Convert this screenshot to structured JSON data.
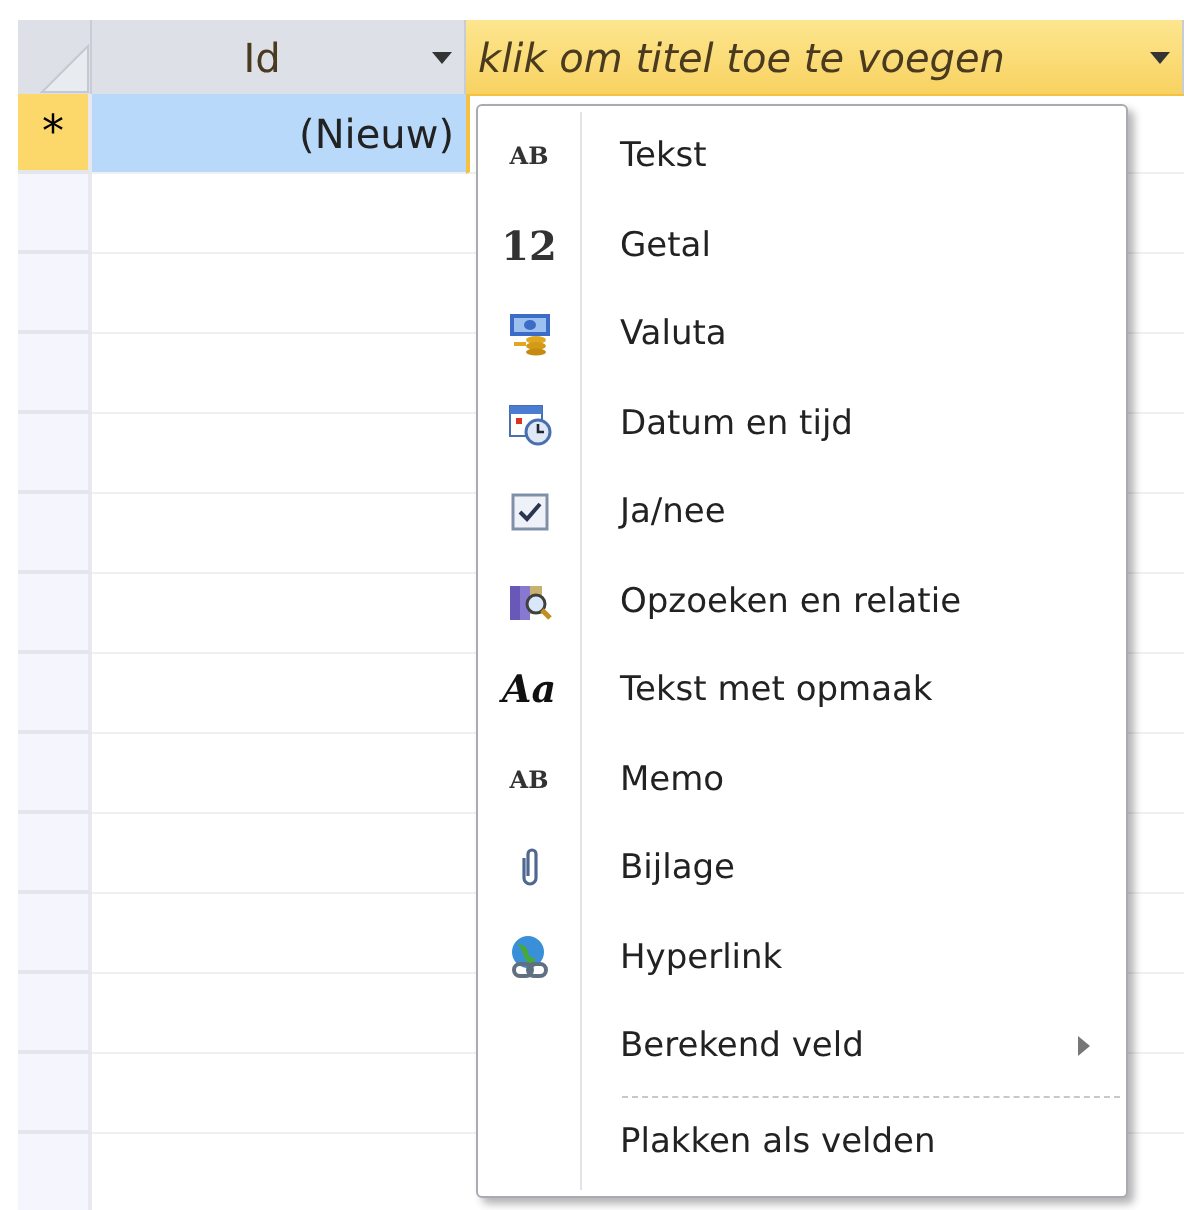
{
  "columns": [
    {
      "title": "Id",
      "selected": false
    },
    {
      "title": "klik om titel toe te voegen",
      "selected": true
    }
  ],
  "new_row": {
    "marker": "*",
    "cells": [
      "(Nieuw)"
    ]
  },
  "menu": {
    "items": [
      {
        "label": "Tekst",
        "kind": "text",
        "icon_text": "AB"
      },
      {
        "label": "Getal",
        "kind": "number",
        "icon_text": "12"
      },
      {
        "label": "Valuta",
        "kind": "currency"
      },
      {
        "label": "Datum en tijd",
        "kind": "datetime"
      },
      {
        "label": "Ja/nee",
        "kind": "checkbox"
      },
      {
        "label": "Opzoeken en relatie",
        "kind": "lookup"
      },
      {
        "label": "Tekst met opmaak",
        "kind": "rich",
        "icon_text": "Aa"
      },
      {
        "label": "Memo",
        "kind": "text",
        "icon_text": "AB"
      },
      {
        "label": "Bijlage",
        "kind": "clip"
      },
      {
        "label": "Hyperlink",
        "kind": "hyperlink"
      },
      {
        "label": "Berekend veld",
        "kind": "plain",
        "submenu": true
      },
      {
        "label": "Plakken als velden",
        "kind": "plain",
        "separator_before": true
      }
    ]
  }
}
